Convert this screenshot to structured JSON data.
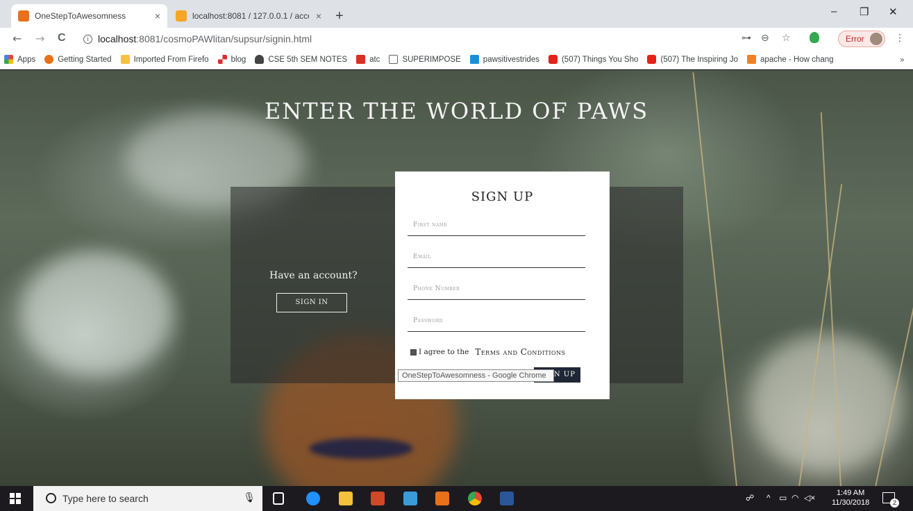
{
  "browser": {
    "tabs": [
      {
        "title": "OneStepToAwesomness",
        "close": "×"
      },
      {
        "title": "localhost:8081 / 127.0.0.1 / accou",
        "close": "×"
      }
    ],
    "new_tab": "+",
    "window_controls": {
      "minimize": "–",
      "restore": "❐",
      "close": "✕"
    },
    "nav": {
      "back": "←",
      "forward": "→",
      "reload": "C"
    },
    "url": {
      "host": "localhost",
      "rest": ":8081/cosmoPAWlitan/supsur/signin.html"
    },
    "toolbar_icons": {
      "key": "⊶",
      "zoom": "⊖",
      "star": "☆",
      "menu": "⋮"
    },
    "error_label": "Error",
    "bookmarks": [
      {
        "label": "Apps",
        "color": "#4285f4"
      },
      {
        "label": "Getting Started",
        "color": "#e8711c"
      },
      {
        "label": "Imported From Firefo",
        "color": "#f6c244"
      },
      {
        "label": "blog",
        "color": "#e02b2b"
      },
      {
        "label": "CSE 5th SEM NOTES",
        "color": "#444444"
      },
      {
        "label": "atc",
        "color": "#d93025"
      },
      {
        "label": "SUPERIMPOSE",
        "color": "#ffffff"
      },
      {
        "label": "pawsitivestrides",
        "color": "#1a8fd9"
      },
      {
        "label": "(507) Things You Sho",
        "color": "#e62117"
      },
      {
        "label": "(507) The Inspiring Jo",
        "color": "#e62117"
      },
      {
        "label": "apache - How chang",
        "color": "#f48024"
      }
    ],
    "bookmarks_more": "»"
  },
  "page": {
    "hero_title": "ENTER THE WORLD OF PAWS",
    "have_account": "Have an account?",
    "signin_button": "SIGN IN",
    "form": {
      "title": "SIGN UP",
      "fields": {
        "first_name": "First name",
        "email": "Email",
        "phone": "Phone Number",
        "password": "Password"
      },
      "agree_text": "I agree to the",
      "terms_link": "Terms and Conditions",
      "submit": "SIGN UP"
    },
    "tooltip": "OneStepToAwesomness - Google Chrome"
  },
  "taskbar": {
    "search_placeholder": "Type here to search",
    "time": "1:49 AM",
    "date": "11/30/2018",
    "notification_count": "2"
  }
}
